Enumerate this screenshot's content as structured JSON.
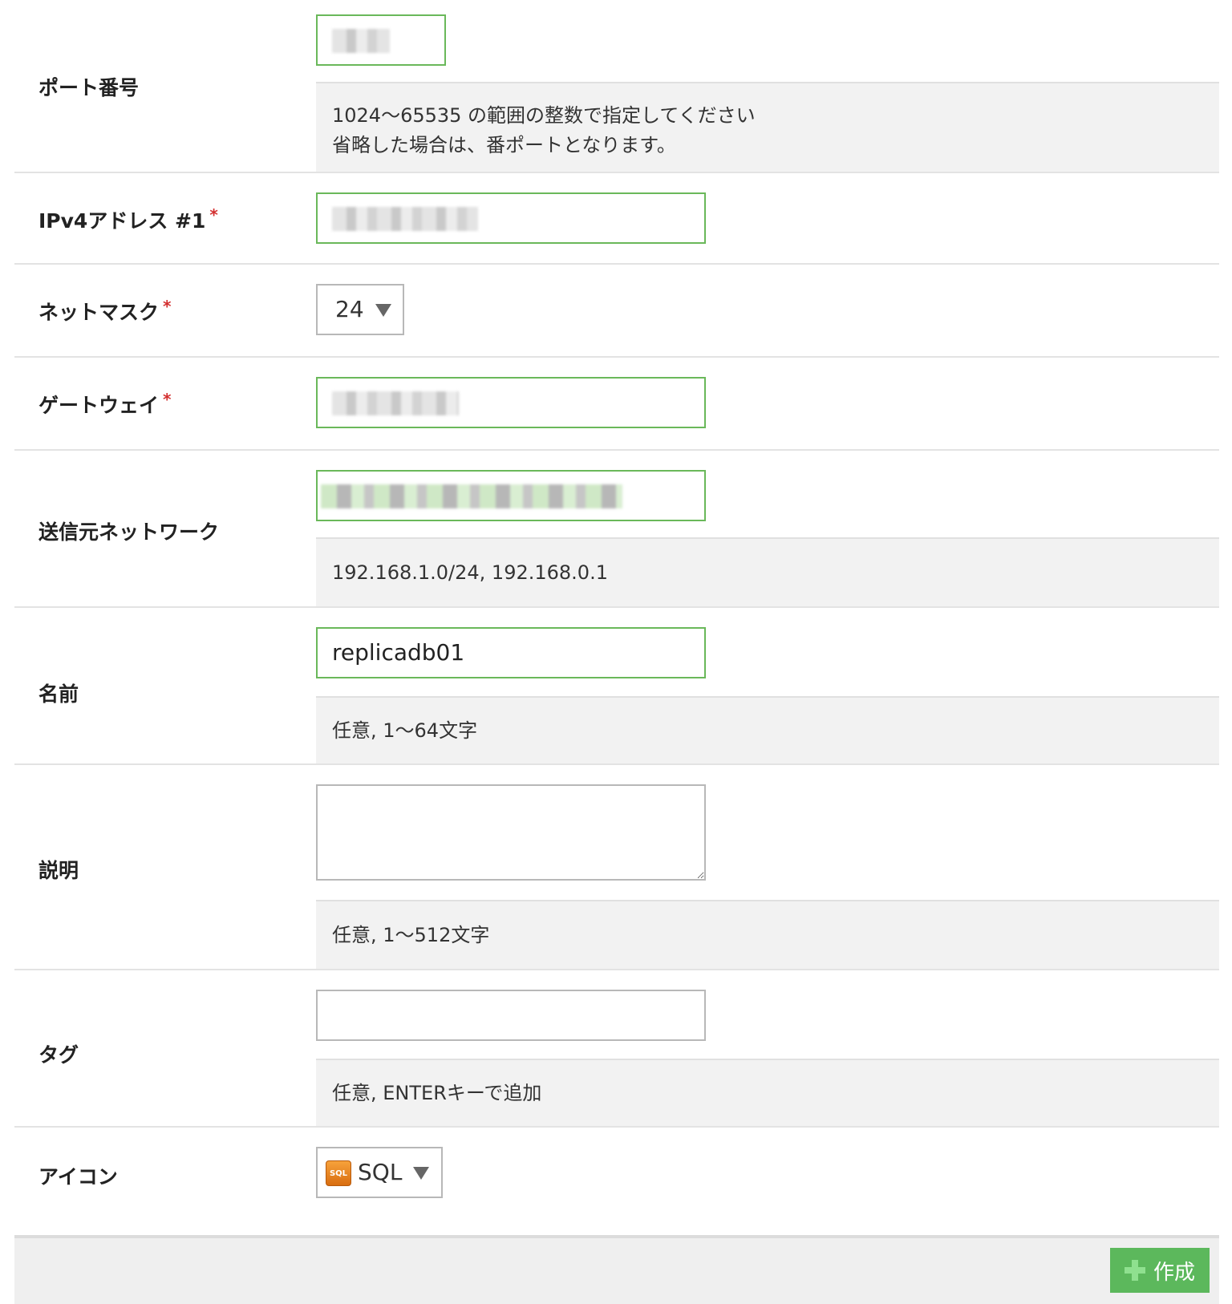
{
  "form": {
    "port": {
      "label": "ポート番号",
      "value": "",
      "hint_line1": "1024〜65535 の範囲の整数で指定してください",
      "hint_line2": "省略した場合は、番ポートとなります。"
    },
    "ipv4": {
      "label": "IPv4アドレス #1",
      "required_mark": "*",
      "value": ""
    },
    "netmask": {
      "label": "ネットマスク",
      "required_mark": "*",
      "selected": "24"
    },
    "gateway": {
      "label": "ゲートウェイ",
      "required_mark": "*",
      "value": ""
    },
    "source_network": {
      "label": "送信元ネットワーク",
      "value": "",
      "hint": "192.168.1.0/24, 192.168.0.1"
    },
    "name": {
      "label": "名前",
      "value": "replicadb01",
      "hint": "任意, 1〜64文字"
    },
    "description": {
      "label": "説明",
      "value": "",
      "hint": "任意, 1〜512文字"
    },
    "tags": {
      "label": "タグ",
      "value": "",
      "hint": "任意, ENTERキーで追加"
    },
    "icon": {
      "label": "アイコン",
      "icon_text": "SQL",
      "selected": "SQL"
    }
  },
  "footer": {
    "create_label": "作成",
    "create_icon": "plus-icon"
  },
  "colors": {
    "input_border_active": "#6ab85a",
    "required": "#d32f2f",
    "create_button": "#5cb85c",
    "hint_background": "#f2f2f2"
  }
}
